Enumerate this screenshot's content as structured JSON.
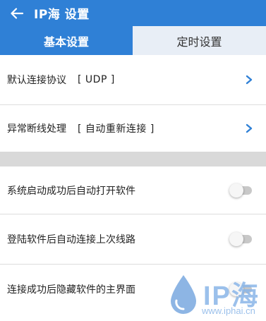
{
  "header": {
    "title": "IP海 设置",
    "back_icon": "arrow-left-icon"
  },
  "tabs": [
    {
      "label": "基本设置",
      "active": true
    },
    {
      "label": "定时设置",
      "active": false
    }
  ],
  "settings": {
    "protocol": {
      "label": "默认连接协议",
      "value": "[ UDP ]"
    },
    "disconnect": {
      "label": "异常断线处理",
      "value": "[ 自动重新连接 ]"
    }
  },
  "toggles": [
    {
      "label": "系统启动成功后自动打开软件",
      "on": false
    },
    {
      "label": "登陆软件后自动连接上次线路",
      "on": false
    },
    {
      "label": "连接成功后隐藏软件的主界面",
      "on": false
    }
  ],
  "watermark": {
    "text": "IP海",
    "url": "www.iphai.cn"
  },
  "colors": {
    "primary": "#2f80d6",
    "chevron": "#2f80d6",
    "toggle_off": "#c8c8c8"
  }
}
